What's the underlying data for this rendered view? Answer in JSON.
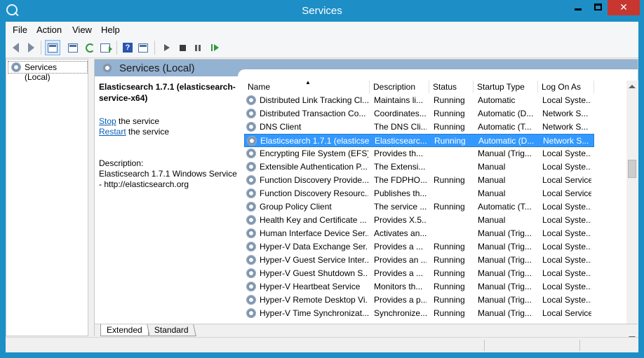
{
  "window": {
    "title": "Services"
  },
  "menu": [
    "File",
    "Action",
    "View",
    "Help"
  ],
  "tree": {
    "item": "Services (Local)"
  },
  "content": {
    "title": "Services (Local)"
  },
  "details": {
    "name": "Elasticsearch 1.7.1 (elasticsearch-service-x64)",
    "stop_link": "Stop",
    "stop_rest": " the service",
    "restart_link": "Restart",
    "restart_rest": " the service",
    "desc_label": "Description:",
    "desc_text": "Elasticsearch 1.7.1 Windows Service - http://elasticsearch.org"
  },
  "columns": [
    "Name",
    "Description",
    "Status",
    "Startup Type",
    "Log On As"
  ],
  "rows": [
    [
      "Distributed Link Tracking Cl...",
      "Maintains li...",
      "Running",
      "Automatic",
      "Local Syste..."
    ],
    [
      "Distributed Transaction Co...",
      "Coordinates...",
      "Running",
      "Automatic (D...",
      "Network S..."
    ],
    [
      "DNS Client",
      "The DNS Cli...",
      "Running",
      "Automatic (T...",
      "Network S..."
    ],
    [
      "Elasticsearch 1.7.1 (elasticse...",
      "Elasticsearc...",
      "Running",
      "Automatic (D...",
      "Network S..."
    ],
    [
      "Encrypting File System (EFS)",
      "Provides th...",
      "",
      "Manual (Trig...",
      "Local Syste..."
    ],
    [
      "Extensible Authentication P...",
      "The Extensi...",
      "",
      "Manual",
      "Local Syste..."
    ],
    [
      "Function Discovery Provide...",
      "The FDPHO...",
      "Running",
      "Manual",
      "Local Service"
    ],
    [
      "Function Discovery Resourc...",
      "Publishes th...",
      "",
      "Manual",
      "Local Service"
    ],
    [
      "Group Policy Client",
      "The service ...",
      "Running",
      "Automatic (T...",
      "Local Syste..."
    ],
    [
      "Health Key and Certificate ...",
      "Provides X.5...",
      "",
      "Manual",
      "Local Syste..."
    ],
    [
      "Human Interface Device Ser...",
      "Activates an...",
      "",
      "Manual (Trig...",
      "Local Syste..."
    ],
    [
      "Hyper-V Data Exchange Ser...",
      "Provides a ...",
      "Running",
      "Manual (Trig...",
      "Local Syste..."
    ],
    [
      "Hyper-V Guest Service Inter...",
      "Provides an ...",
      "Running",
      "Manual (Trig...",
      "Local Syste..."
    ],
    [
      "Hyper-V Guest Shutdown S...",
      "Provides a ...",
      "Running",
      "Manual (Trig...",
      "Local Syste..."
    ],
    [
      "Hyper-V Heartbeat Service",
      "Monitors th...",
      "Running",
      "Manual (Trig...",
      "Local Syste..."
    ],
    [
      "Hyper-V Remote Desktop Vi...",
      "Provides a p...",
      "Running",
      "Manual (Trig...",
      "Local Syste..."
    ],
    [
      "Hyper-V Time Synchronizat...",
      "Synchronize...",
      "Running",
      "Manual (Trig...",
      "Local Service"
    ]
  ],
  "tabs": [
    "Extended",
    "Standard"
  ],
  "colors": {
    "title_bar": "#1d8fc6",
    "close_button": "#c7372f",
    "selection": "#3399ff",
    "header_band": "#94b2d1",
    "link": "#0b5fb4"
  }
}
